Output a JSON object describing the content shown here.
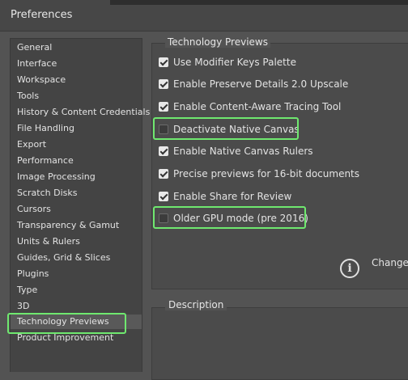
{
  "window": {
    "title": "Preferences"
  },
  "sidebar": {
    "items": [
      {
        "label": "General"
      },
      {
        "label": "Interface"
      },
      {
        "label": "Workspace"
      },
      {
        "label": "Tools"
      },
      {
        "label": "History & Content Credentials"
      },
      {
        "label": "File Handling"
      },
      {
        "label": "Export"
      },
      {
        "label": "Performance"
      },
      {
        "label": "Image Processing"
      },
      {
        "label": "Scratch Disks"
      },
      {
        "label": "Cursors"
      },
      {
        "label": "Transparency & Gamut"
      },
      {
        "label": "Units & Rulers"
      },
      {
        "label": "Guides, Grid & Slices"
      },
      {
        "label": "Plugins"
      },
      {
        "label": "Type"
      },
      {
        "label": "3D"
      },
      {
        "label": "Technology Previews",
        "selected": true
      },
      {
        "label": "Product Improvement"
      }
    ]
  },
  "tech_previews": {
    "title": "Technology Previews",
    "options": [
      {
        "label": "Use Modifier Keys Palette",
        "checked": true
      },
      {
        "label": "Enable Preserve Details 2.0 Upscale",
        "checked": true
      },
      {
        "label": "Enable Content-Aware Tracing Tool",
        "checked": true
      },
      {
        "label": "Deactivate Native Canvas",
        "checked": false
      },
      {
        "label": "Enable Native Canvas Rulers",
        "checked": true
      },
      {
        "label": "Precise previews for 16-bit documents",
        "checked": true
      },
      {
        "label": "Enable Share for Review",
        "checked": true
      },
      {
        "label": "Older GPU mode (pre 2016)",
        "checked": false
      }
    ],
    "info_text": "Changes"
  },
  "description": {
    "title": "Description"
  },
  "colors": {
    "highlight": "#6fe86f",
    "background": "#535353"
  }
}
